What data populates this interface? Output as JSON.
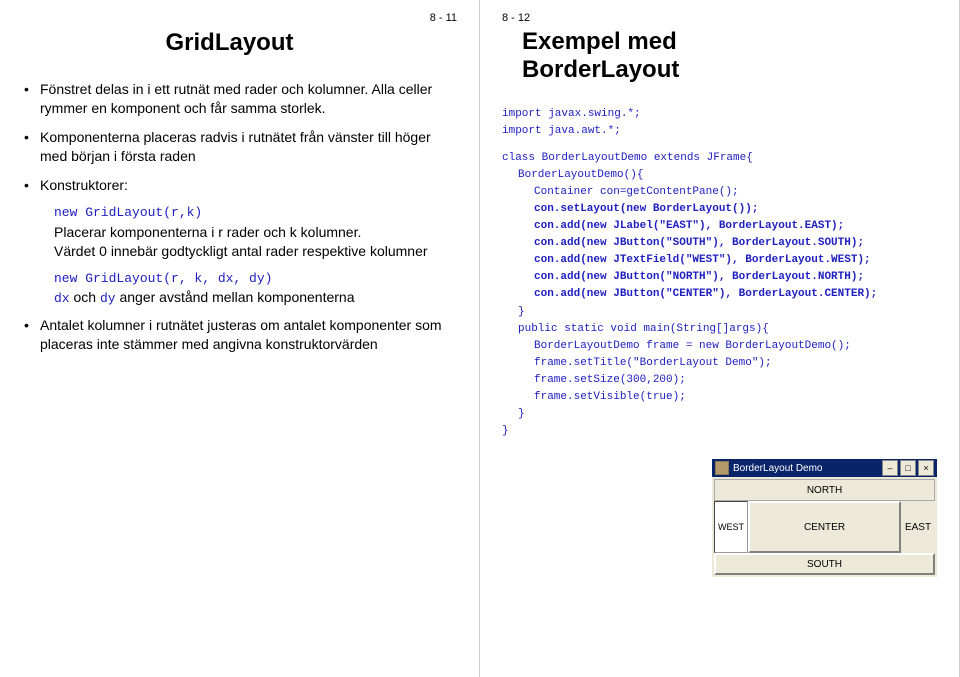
{
  "left": {
    "page": "8 - 11",
    "title": "GridLayout",
    "b1": "Fönstret delas in i ett rutnät med rader och kolumner. Alla celler rymmer en komponent och får samma storlek.",
    "b2": "Komponenterna placeras radvis i rutnätet från vänster till höger med början i första raden",
    "b3": "Konstruktorer:",
    "code1": "new GridLayout(r,k)",
    "s1": "Placerar komponenterna i r rader och k kolumner.",
    "s2": "Värdet 0 innebär godtyckligt antal rader respektive kolumner",
    "code2": "new GridLayout(r, k, dx, dy)",
    "s3a": "dx",
    "s3b": " och ",
    "s3c": "dy",
    "s3d": " anger avstånd mellan komponenterna",
    "b4": "Antalet kolumner i rutnätet justeras om antalet komponenter som placeras inte stämmer med angivna konstruktorvärden"
  },
  "right": {
    "page": "8 - 12",
    "title_l1": "Exempel med",
    "title_l2": "BorderLayout",
    "code": {
      "l1": "import javax.swing.*;",
      "l2": "import java.awt.*;",
      "l3": "class BorderLayoutDemo extends JFrame{",
      "l4": "BorderLayoutDemo(){",
      "l5": "Container con=getContentPane();",
      "l6": "con.setLayout(new BorderLayout());",
      "l7": "con.add(new JLabel(\"EAST\"), BorderLayout.EAST);",
      "l8": "con.add(new JButton(\"SOUTH\"), BorderLayout.SOUTH);",
      "l9": "con.add(new JTextField(\"WEST\"), BorderLayout.WEST);",
      "l10": "con.add(new JButton(\"NORTH\"), BorderLayout.NORTH);",
      "l11": "con.add(new JButton(\"CENTER\"), BorderLayout.CENTER);",
      "l12": "}",
      "l13": "public static void main(String[]args){",
      "l14": "BorderLayoutDemo frame = new BorderLayoutDemo();",
      "l15": "frame.setTitle(\"BorderLayout Demo\");",
      "l16": "frame.setSize(300,200);",
      "l17": "frame.setVisible(true);",
      "l18": "}",
      "l19": "}"
    },
    "win": {
      "title": "BorderLayout Demo",
      "north": "NORTH",
      "south": "SOUTH",
      "west": "WEST",
      "east": "EAST",
      "center": "CENTER"
    }
  }
}
